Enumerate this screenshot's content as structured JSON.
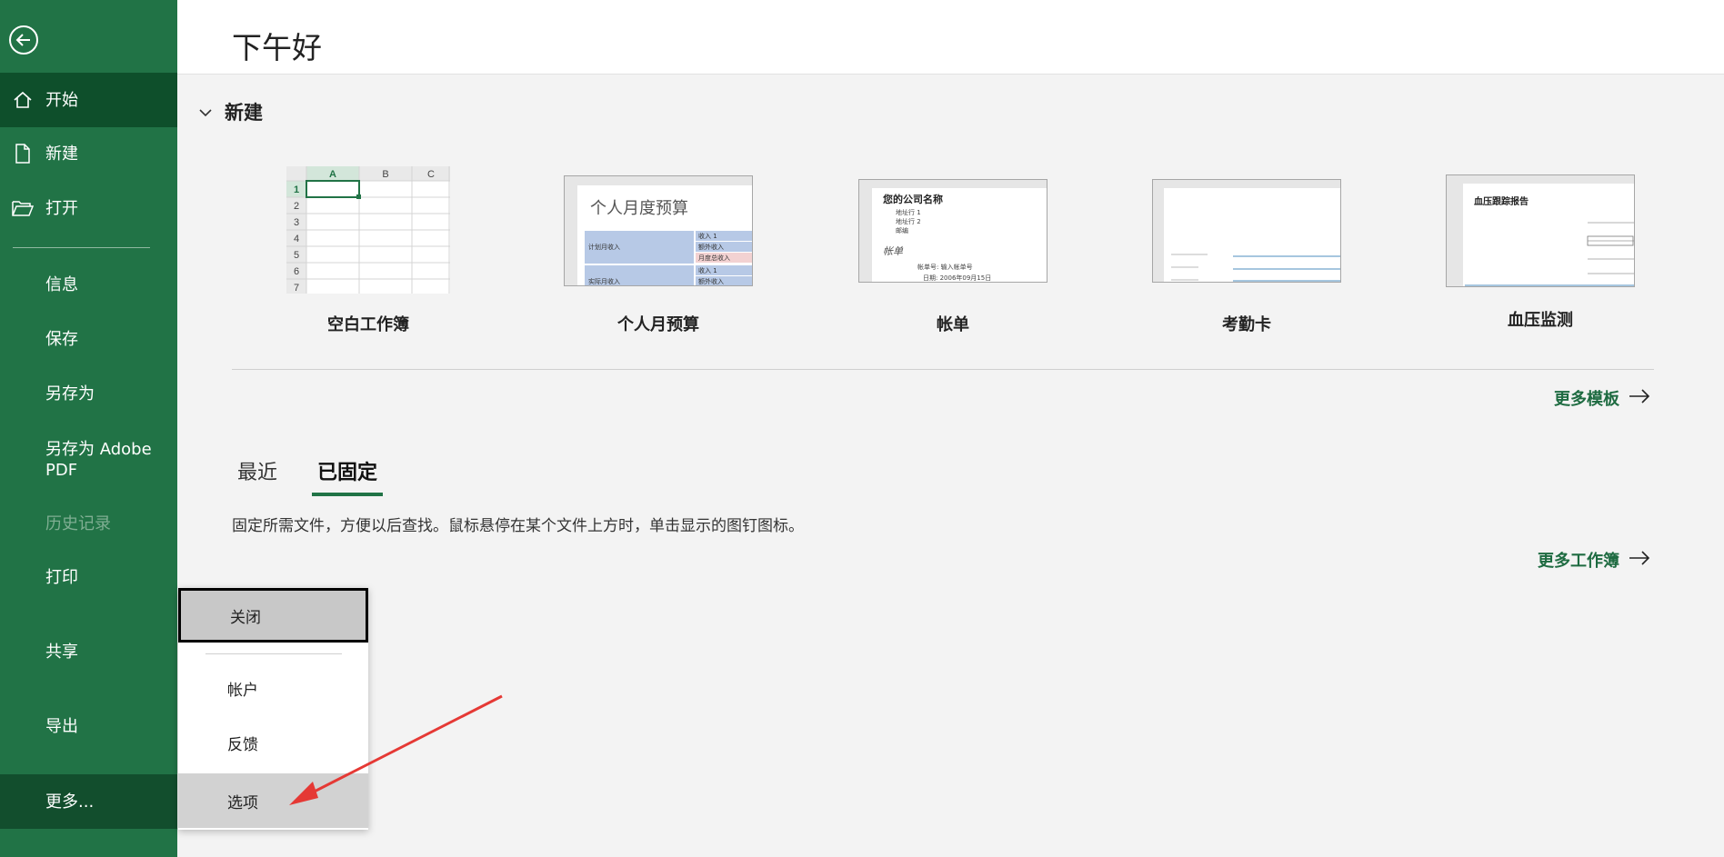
{
  "header": {
    "greeting": "下午好"
  },
  "sidebar": {
    "items": [
      {
        "label": "开始",
        "icon": "home-icon"
      },
      {
        "label": "新建",
        "icon": "new-file-icon"
      },
      {
        "label": "打开",
        "icon": "open-folder-icon"
      },
      {
        "label": "信息"
      },
      {
        "label": "保存"
      },
      {
        "label": "另存为"
      },
      {
        "label": "另存为 Adobe PDF"
      },
      {
        "label": "历史记录"
      },
      {
        "label": "打印"
      },
      {
        "label": "共享"
      },
      {
        "label": "导出"
      },
      {
        "label": "更多..."
      }
    ]
  },
  "new_section": {
    "title": "新建",
    "templates": [
      {
        "name": "空白工作簿"
      },
      {
        "name": "个人月预算"
      },
      {
        "name": "帐单"
      },
      {
        "name": "考勤卡"
      },
      {
        "name": "血压监测"
      }
    ],
    "more_templates": "更多模板"
  },
  "recent_section": {
    "tabs": [
      "最近",
      "已固定"
    ],
    "active_tab": "已固定",
    "hint": "固定所需文件，方便以后查找。鼠标悬停在某个文件上方时，单击显示的图钉图标。",
    "more_workbooks": "更多工作簿"
  },
  "popup_menu": {
    "items": [
      "关闭",
      "帐户",
      "反馈",
      "选项"
    ]
  },
  "thumbnails": {
    "blank": {
      "cols": [
        "A",
        "B",
        "C"
      ],
      "rows": [
        "1",
        "2",
        "3",
        "4",
        "5",
        "6",
        "7"
      ]
    },
    "budget": {
      "title": "个人月度预算",
      "row1": "计划月收入",
      "row2": "实际月收入",
      "cells": [
        "收入 1",
        "额外收入",
        "月度总收入",
        "收入 1",
        "额外收入"
      ]
    },
    "invoice": {
      "company": "您的公司名称",
      "lines": [
        "地址行 1",
        "地址行 2",
        "邮编"
      ],
      "title": "帐单",
      "invoice_no": "帐单号: 输入帐单号",
      "date": "日期: 2006年09月15日"
    },
    "bp": {
      "title": "血压跟踪报告"
    }
  },
  "colors": {
    "accent": "#217346",
    "sidebar_active": "#0e4f2b",
    "link": "#1e6b41",
    "arrow": "#e53935"
  }
}
